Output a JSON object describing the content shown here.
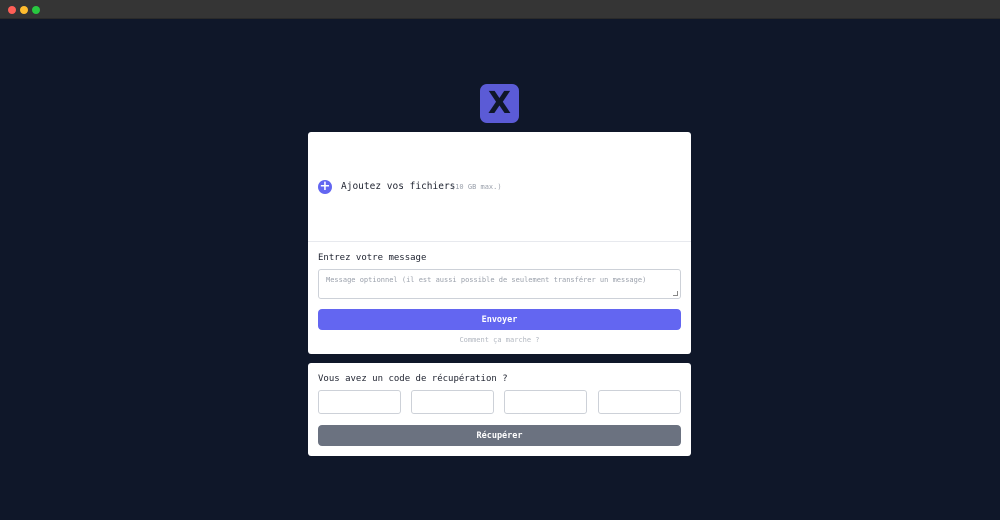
{
  "window": {
    "controls": [
      "close",
      "minimize",
      "maximize"
    ]
  },
  "logo": {
    "text": "X",
    "color": "#5b5bd6"
  },
  "upload": {
    "add_label": "Ajoutez vos fichiers",
    "limit_hint": "(10 GB max.)",
    "icon": "plus-circle-icon"
  },
  "message": {
    "label": "Entrez votre message",
    "placeholder": "Message optionnel (il est aussi possible de seulement transférer un message)",
    "value": ""
  },
  "send_button": {
    "label": "Envoyer",
    "color": "#6366f1"
  },
  "help_link": {
    "label": "Comment ça marche ?"
  },
  "recovery": {
    "label": "Vous avez un code de récupération ?",
    "codes": [
      "",
      "",
      "",
      ""
    ],
    "button_label": "Récupérer",
    "button_color": "#6b7280"
  },
  "colors": {
    "background": "#0f1729",
    "card": "#ffffff",
    "accent": "#6366f1"
  }
}
